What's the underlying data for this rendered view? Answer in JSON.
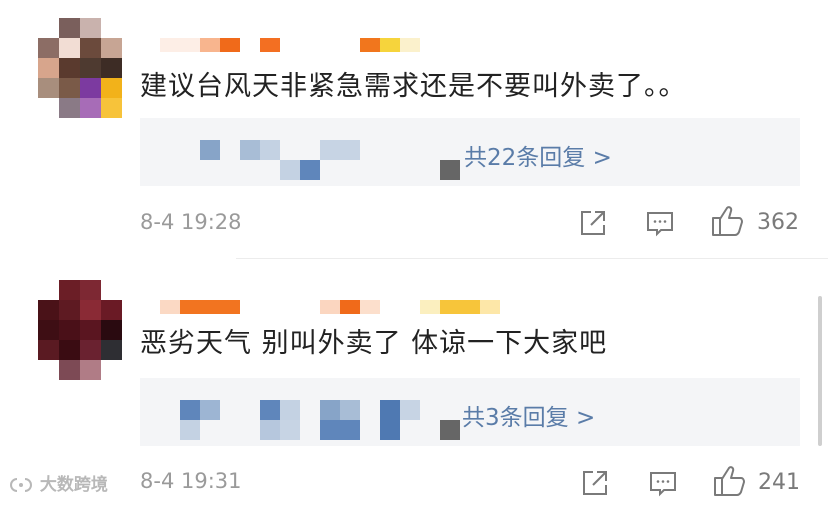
{
  "comments": [
    {
      "text": "建议台风天非紧急需求还是不要叫外卖了。。",
      "reply_link": "共22条回复 >",
      "time": "8-4 19:28",
      "likes": "362"
    },
    {
      "text": "恶劣天气 别叫外卖了 体谅一下大家吧",
      "reply_link": "共3条回复 >",
      "time": "8-4 19:31",
      "likes": "241"
    }
  ],
  "icons": {
    "share": "share-icon",
    "comment": "comment-icon",
    "like": "thumbs-up-icon"
  },
  "watermark": {
    "text": "大数跨境"
  },
  "colors": {
    "link": "#5a7ca8",
    "reply_bg": "#f4f5f7",
    "meta": "#9a9a9a"
  }
}
